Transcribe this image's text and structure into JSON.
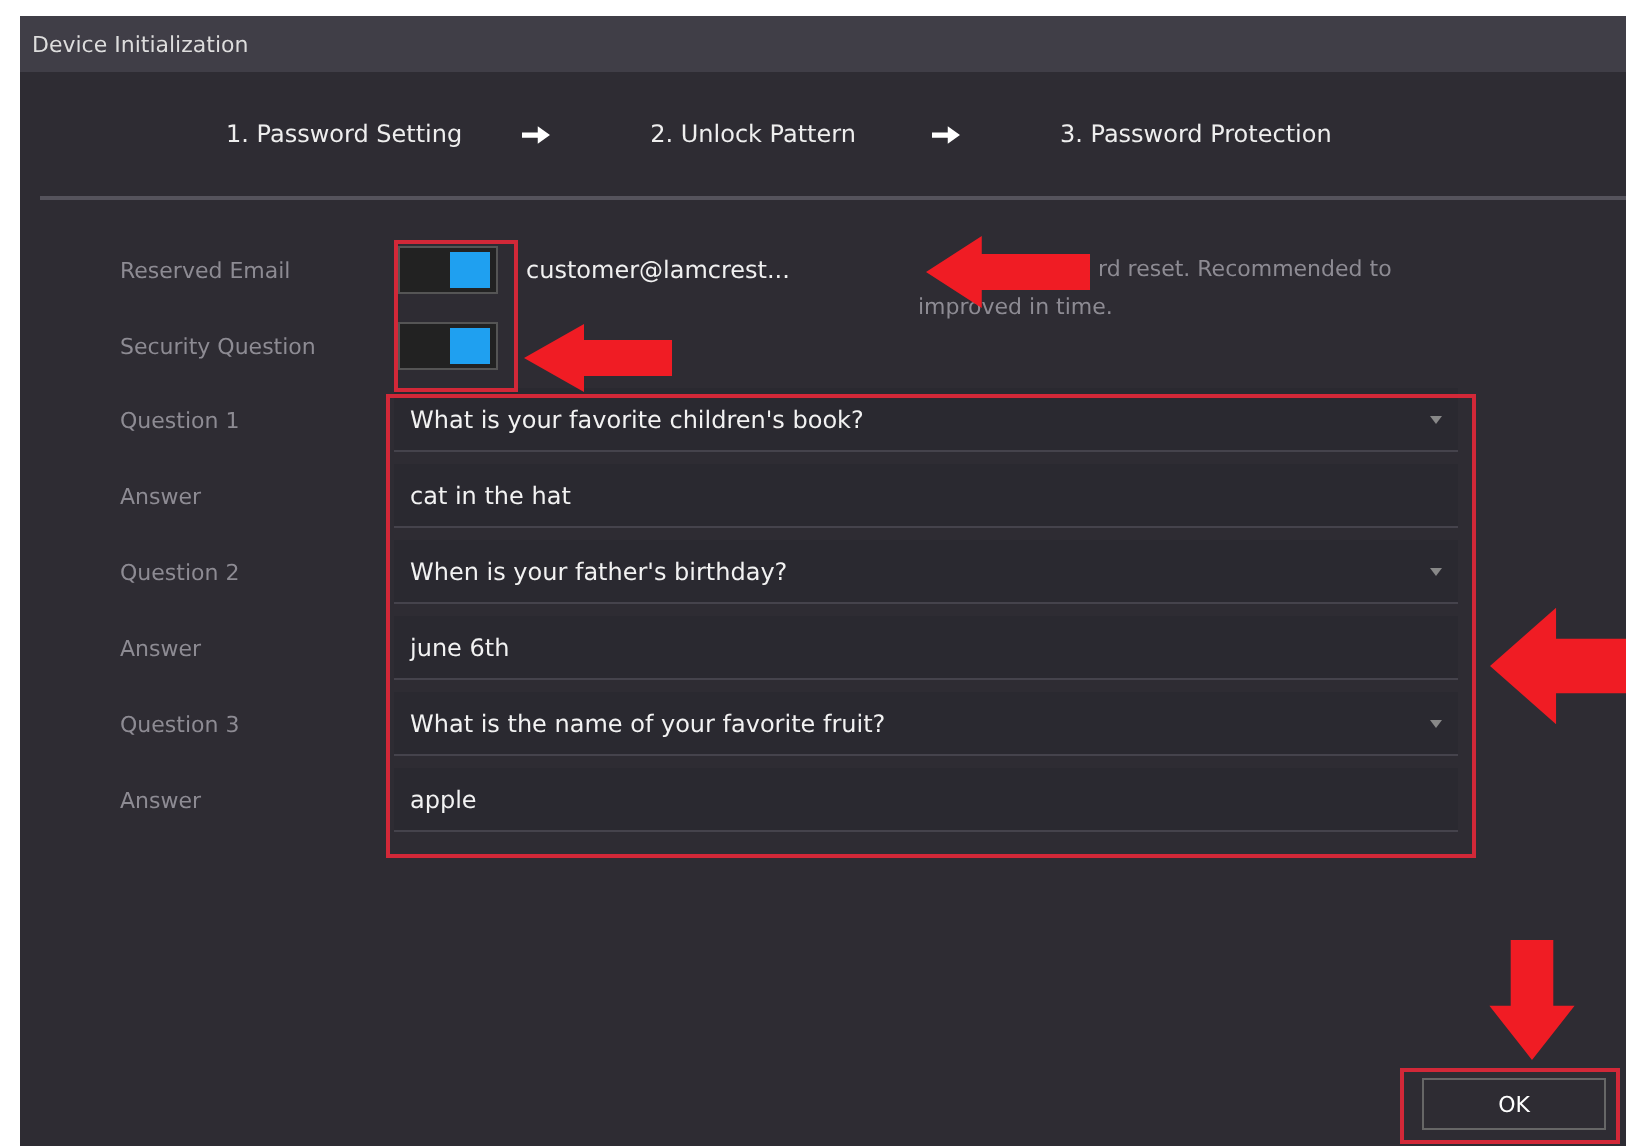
{
  "window": {
    "title": "Device Initialization"
  },
  "steps": [
    {
      "label": "1. Password Setting"
    },
    {
      "label": "2. Unlock Pattern"
    },
    {
      "label": "3. Password Protection"
    }
  ],
  "settings": [
    {
      "kind": "toggle",
      "label": "Reserved Email",
      "on": true,
      "value": "customer@lamcrest..."
    },
    {
      "kind": "toggle",
      "label": "Security Question",
      "on": true
    }
  ],
  "hint_lines": [
    "rd reset. Recommended to",
    "improved in time."
  ],
  "questions": [
    {
      "kind": "select",
      "label": "Question 1",
      "value": "What is your favorite children's book?"
    },
    {
      "kind": "text",
      "label": "Answer",
      "value": "cat in the hat"
    },
    {
      "kind": "select",
      "label": "Question 2",
      "value": "When is your father's birthday?"
    },
    {
      "kind": "text",
      "label": "Answer",
      "value": "june 6th"
    },
    {
      "kind": "select",
      "label": "Question 3",
      "value": "What is the name of your favorite fruit?"
    },
    {
      "kind": "text",
      "label": "Answer",
      "value": "apple"
    }
  ],
  "buttons": [
    {
      "label": "OK"
    }
  ]
}
